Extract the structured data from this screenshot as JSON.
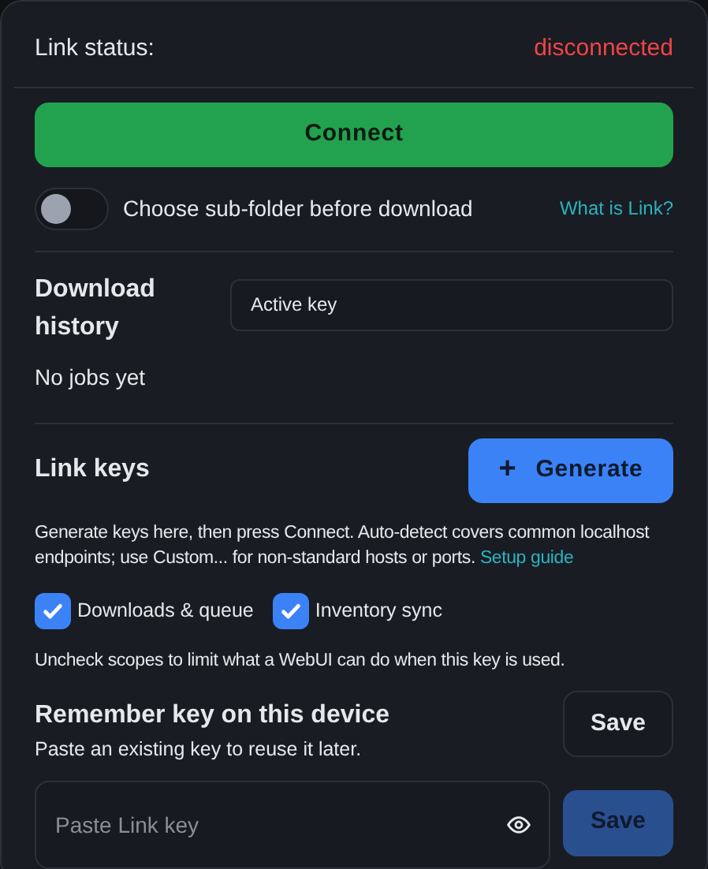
{
  "status": {
    "label": "Link status:",
    "value": "disconnected",
    "connected": false
  },
  "connect_button": "Connect",
  "subfolder_toggle": {
    "label": "Choose sub-folder before download",
    "on": false
  },
  "help_link": "What is Link?",
  "history": {
    "title": "Download history",
    "empty_text": "No jobs yet",
    "key_field": {
      "value": "Active key"
    }
  },
  "link_keys": {
    "title": "Link keys",
    "generate_button": {
      "icon": "+",
      "label": "Generate"
    },
    "description": "Generate keys here, then press Connect. Auto-detect covers common localhost endpoints; use Custom... for non-standard hosts or ports.",
    "guide_link": "Setup guide",
    "scopes": [
      {
        "label": "Downloads & queue",
        "checked": true
      },
      {
        "label": "Inventory sync",
        "checked": true
      }
    ],
    "scope_note": "Uncheck scopes to limit what a WebUI can do when this key is used."
  },
  "remember": {
    "title": "Remember key on this device",
    "subtitle": "Paste an existing key to reuse it later.",
    "save_button": {
      "label": "Save",
      "disabled": false
    },
    "key_field": {
      "placeholder": "Paste Link key"
    },
    "field_save_button": {
      "label": "Save",
      "disabled": true
    }
  }
}
